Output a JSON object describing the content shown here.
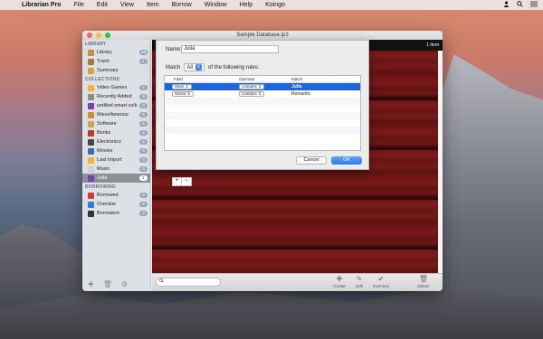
{
  "menubar": {
    "app_name": "Librarian Pro",
    "items": [
      "File",
      "Edit",
      "View",
      "Item",
      "Borrow",
      "Window",
      "Help",
      "Koingo"
    ]
  },
  "window": {
    "title": "Sample Database.lp3"
  },
  "sidebar": {
    "library_header": "LIBRARY",
    "library_items": [
      {
        "label": "Library",
        "count": "26",
        "icon": "library-icon",
        "color": "#c98b3c"
      },
      {
        "label": "Trash",
        "count": "1",
        "icon": "trash-icon",
        "color": "#a07946"
      },
      {
        "label": "Summary",
        "count": "",
        "icon": "summary-icon",
        "color": "#d9a23c"
      }
    ],
    "collections_header": "COLLECTIONS",
    "collection_items": [
      {
        "label": "Video Games",
        "count": "4",
        "icon": "video-games-icon",
        "color": "#f1b628"
      },
      {
        "label": "Recently Added",
        "count": "0",
        "icon": "recently-added-icon",
        "color": "#8e8e8e"
      },
      {
        "label": "untitled smart colle...",
        "count": "0",
        "icon": "smart-collection-icon",
        "color": "#7a3fb0"
      },
      {
        "label": "Miscellaneous",
        "count": "8",
        "icon": "miscellaneous-icon",
        "color": "#c98b3c"
      },
      {
        "label": "Software",
        "count": "8",
        "icon": "software-icon",
        "color": "#d0a058"
      },
      {
        "label": "Books",
        "count": "4",
        "icon": "books-icon",
        "color": "#c0392b"
      },
      {
        "label": "Electronics",
        "count": "5",
        "icon": "electronics-icon",
        "color": "#444444"
      },
      {
        "label": "Movies",
        "count": "6",
        "icon": "movies-icon",
        "color": "#3a6ea5"
      },
      {
        "label": "Last Import",
        "count": "0",
        "icon": "last-import-icon",
        "color": "#f1b628"
      },
      {
        "label": "Music",
        "count": "0",
        "icon": "music-icon",
        "color": "#d0d0d0"
      },
      {
        "label": "Julia",
        "count": "1",
        "icon": "julia-icon",
        "color": "#7a3fb0",
        "selected": true
      }
    ],
    "borrowing_header": "BORROWING",
    "borrowing_items": [
      {
        "label": "Borrowed",
        "count": "0",
        "icon": "borrowed-icon",
        "color": "#d83b3b"
      },
      {
        "label": "Overdue",
        "count": "0",
        "icon": "overdue-icon",
        "color": "#2f7be9"
      },
      {
        "label": "Borrowers",
        "count": "3",
        "icon": "borrowers-icon",
        "color": "#333333"
      }
    ]
  },
  "main": {
    "item_count": "1 Item",
    "search_placeholder": "",
    "toolbar": {
      "create": "Create",
      "edit": "Edit",
      "inventory": "Inventory",
      "delete": "Delete"
    }
  },
  "sheet": {
    "name_label": "Name:",
    "name_value": "Julia",
    "match_label": "Match",
    "match_value": "All",
    "match_suffix": "of the following rules:",
    "headers": {
      "field": "Field",
      "operator": "Operator",
      "match": "Match"
    },
    "rules": [
      {
        "field": "Stars",
        "operator": "contains",
        "match": "Julia",
        "selected": true
      },
      {
        "field": "Genre",
        "operator": "contains",
        "match": "Romantic",
        "selected": false
      }
    ],
    "plus": "+",
    "minus": "−",
    "cancel": "Cancel",
    "ok": "OK"
  }
}
